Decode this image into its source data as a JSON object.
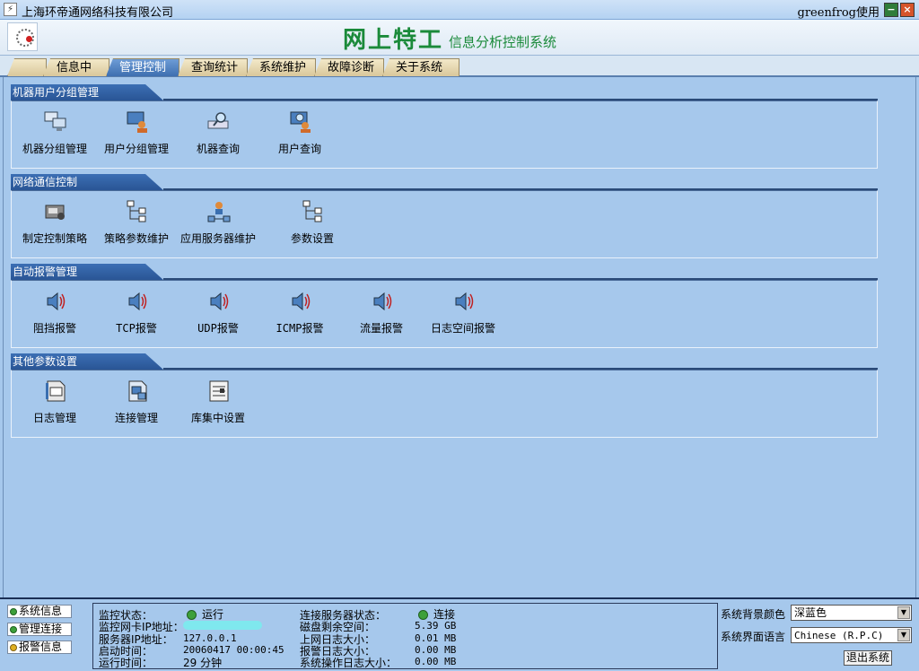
{
  "window": {
    "title": "上海环帝通网络科技有限公司",
    "user": "greenfrog使用"
  },
  "banner": {
    "main": "网上特工",
    "sub": "信息分析控制系统"
  },
  "tabs": [
    "信息中心",
    "管理控制",
    "查询统计",
    "系统维护",
    "故障诊断",
    "关于系统"
  ],
  "active_tab": "管理控制",
  "sections": [
    {
      "title": "机器用户分组管理",
      "items": [
        "机器分组管理",
        "用户分组管理",
        "机器查询",
        "用户查询"
      ]
    },
    {
      "title": "网络通信控制",
      "items": [
        "制定控制策略",
        "策略参数维护",
        "应用服务器维护",
        "参数设置"
      ]
    },
    {
      "title": "自动报警管理",
      "items": [
        "阻挡报警",
        "TCP报警",
        "UDP报警",
        "ICMP报警",
        "流量报警",
        "日志空间报警"
      ]
    },
    {
      "title": "其他参数设置",
      "items": [
        "日志管理",
        "连接管理",
        "库集中设置"
      ]
    }
  ],
  "footer": {
    "buttons": [
      "系统信息",
      "管理连接",
      "报警信息"
    ],
    "left_labels": [
      "监控状态：",
      "监控网卡IP地址：",
      "服务器IP地址：",
      "启动时间：",
      "运行时间："
    ],
    "left_values": [
      "运行",
      "",
      "127.0.0.1",
      "20060417 00:00:45",
      "29 分钟"
    ],
    "right_labels": [
      "连接服务器状态：",
      "磁盘剩余空间：",
      "上网日志大小：",
      "报警日志大小：",
      "系统操作日志大小："
    ],
    "right_values": [
      "连接",
      "5.39 GB",
      "0.01 MB",
      "0.00 MB",
      "0.00 MB"
    ],
    "bg_color_label": "系统背景颜色",
    "bg_color_value": "深蓝色",
    "lang_label": "系统界面语言",
    "lang_value": "Chinese (R.P.C)",
    "exit_label": "退出系统"
  }
}
